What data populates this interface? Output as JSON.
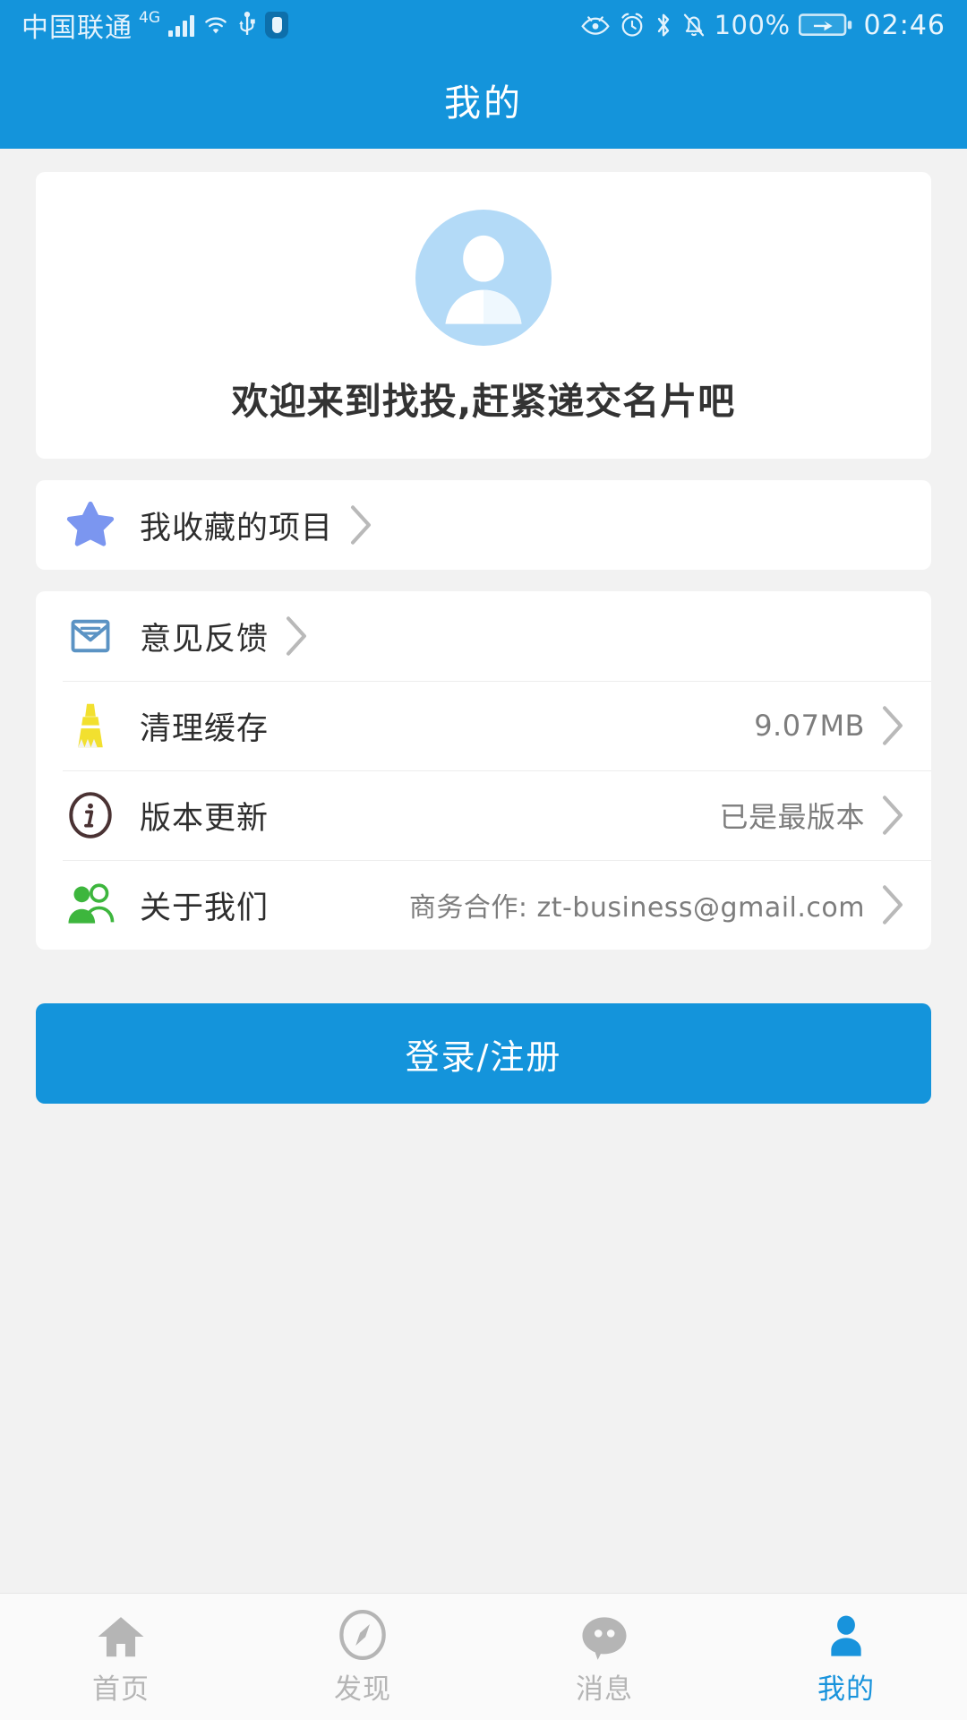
{
  "statusbar": {
    "carrier": "中国联通",
    "network_type": "4G",
    "icons_left": [
      "signal-bars-icon",
      "wifi-icon",
      "usb-icon",
      "shield-icon"
    ],
    "icons_right": [
      "eye-care-icon",
      "alarm-clock-icon",
      "bluetooth-icon",
      "bell-muted-icon"
    ],
    "battery_percent": "100%",
    "battery_icon": "battery-charging-icon",
    "time": "02:46"
  },
  "appbar": {
    "title": "我的"
  },
  "profile": {
    "avatar_icon": "user-avatar-icon",
    "welcome_text": "欢迎来到找投,赶紧递交名片吧"
  },
  "menu_groups": [
    {
      "rows": [
        {
          "icon": "star-icon",
          "label": "我收藏的项目",
          "value": "",
          "chevron": "chevron-right-icon"
        }
      ]
    },
    {
      "rows": [
        {
          "icon": "envelope-icon",
          "label": "意见反馈",
          "value": "",
          "chevron": "chevron-right-icon"
        },
        {
          "icon": "broom-icon",
          "label": "清理缓存",
          "value": "9.07MB",
          "chevron": "chevron-right-icon"
        },
        {
          "icon": "info-circle-icon",
          "label": "版本更新",
          "value": "已是最版本",
          "chevron": "chevron-right-icon"
        },
        {
          "icon": "people-group-icon",
          "label": "关于我们",
          "value": "商务合作: zt-business@gmail.com",
          "chevron": "chevron-right-icon"
        }
      ]
    }
  ],
  "login_button": {
    "label": "登录/注册"
  },
  "tabbar": {
    "tabs": [
      {
        "icon": "home-icon",
        "label": "首页",
        "active": false
      },
      {
        "icon": "compass-icon",
        "label": "发现",
        "active": false
      },
      {
        "icon": "chat-bubble-icon",
        "label": "消息",
        "active": false
      },
      {
        "icon": "person-icon",
        "label": "我的",
        "active": true
      }
    ]
  },
  "colors": {
    "accent": "#1494DB",
    "page_background": "#f2f2f2",
    "card": "#ffffff",
    "star": "#7B96F0",
    "envelope": "#5B93C4",
    "broom": "#F2E02F",
    "info": "#4A3233",
    "people": "#3DB63D",
    "avatar": "#B3DAF7",
    "tab_inactive": "#b5b5b5",
    "tab_active": "#1893DC"
  }
}
